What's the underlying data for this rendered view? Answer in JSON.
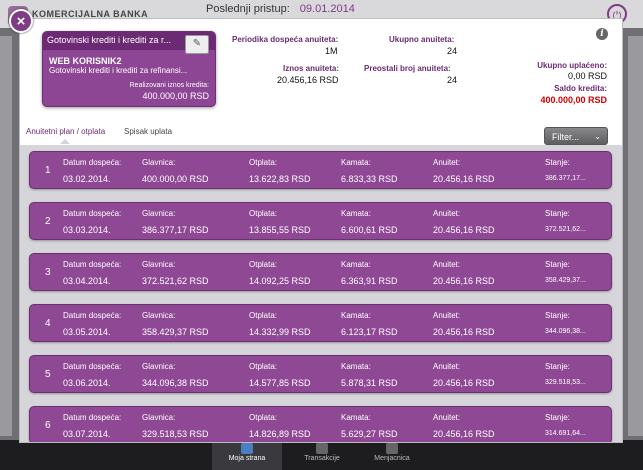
{
  "background": {
    "brand": "KOMERCIJALNA BANKA",
    "last_login_label": "Poslednji pristup:",
    "last_login_value": "09.01.2014",
    "bottom_tabs": [
      {
        "label": "Moja strana",
        "active": true
      },
      {
        "label": "Transakcije",
        "active": false
      },
      {
        "label": "Menjacnica",
        "active": false
      }
    ]
  },
  "card": {
    "title": "Gotovinski krediti i krediti za r...",
    "name": "WEB KORISNIK2",
    "subtitle": "Gotovinski krediti i krediti za refinansi...",
    "realized_label": "Realizovani iznos kredita:",
    "realized_amount": "400.000,00 RSD"
  },
  "summary": {
    "period_label": "Periodika dospeća anuiteta:",
    "period_value": "1M",
    "total_annuities_label": "Ukupno anuiteta:",
    "total_annuities_value": "24",
    "annuity_amount_label": "Iznos anuiteta:",
    "annuity_amount_value": "20.456,16 RSD",
    "remaining_label": "Preostali broj anuiteta:",
    "remaining_value": "24",
    "paid_label": "Ukupno uplaćeno:",
    "paid_value": "0,00 RSD",
    "balance_label": "Saldo kredita:",
    "balance_value": "400.000,00 RSD"
  },
  "tabs": [
    {
      "label": "Anuitetni plan / otplata",
      "active": true
    },
    {
      "label": "Spisak uplata",
      "active": false
    }
  ],
  "filter_label": "Filter...",
  "columns": {
    "due_date": "Datum dospeća:",
    "principal": "Glavnica:",
    "repayment": "Otplata:",
    "interest": "Kamata:",
    "annuity": "Anuitet:",
    "balance": "Stanje:"
  },
  "rows": [
    {
      "index": "1",
      "due_date": "03.02.2014.",
      "principal": "400.000,00 RSD",
      "repayment": "13.622,83 RSD",
      "interest": "6.833,33 RSD",
      "annuity": "20.456,16 RSD",
      "balance": "386.377,17..."
    },
    {
      "index": "2",
      "due_date": "03.03.2014.",
      "principal": "386.377,17 RSD",
      "repayment": "13.855,55 RSD",
      "interest": "6.600,61 RSD",
      "annuity": "20.456,16 RSD",
      "balance": "372.521,62..."
    },
    {
      "index": "3",
      "due_date": "03.04.2014.",
      "principal": "372.521,62 RSD",
      "repayment": "14.092,25 RSD",
      "interest": "6.363,91 RSD",
      "annuity": "20.456,16 RSD",
      "balance": "358.429,37..."
    },
    {
      "index": "4",
      "due_date": "03.05.2014.",
      "principal": "358.429,37 RSD",
      "repayment": "14.332,99 RSD",
      "interest": "6.123,17 RSD",
      "annuity": "20.456,16 RSD",
      "balance": "344.096,38..."
    },
    {
      "index": "5",
      "due_date": "03.06.2014.",
      "principal": "344.096,38 RSD",
      "repayment": "14.577,85 RSD",
      "interest": "5.878,31 RSD",
      "annuity": "20.456,16 RSD",
      "balance": "329.518,53..."
    },
    {
      "index": "6",
      "due_date": "03.07.2014.",
      "principal": "329.518,53 RSD",
      "repayment": "14.826,89 RSD",
      "interest": "5.629,27 RSD",
      "annuity": "20.456,16 RSD",
      "balance": "314.691,64..."
    }
  ]
}
